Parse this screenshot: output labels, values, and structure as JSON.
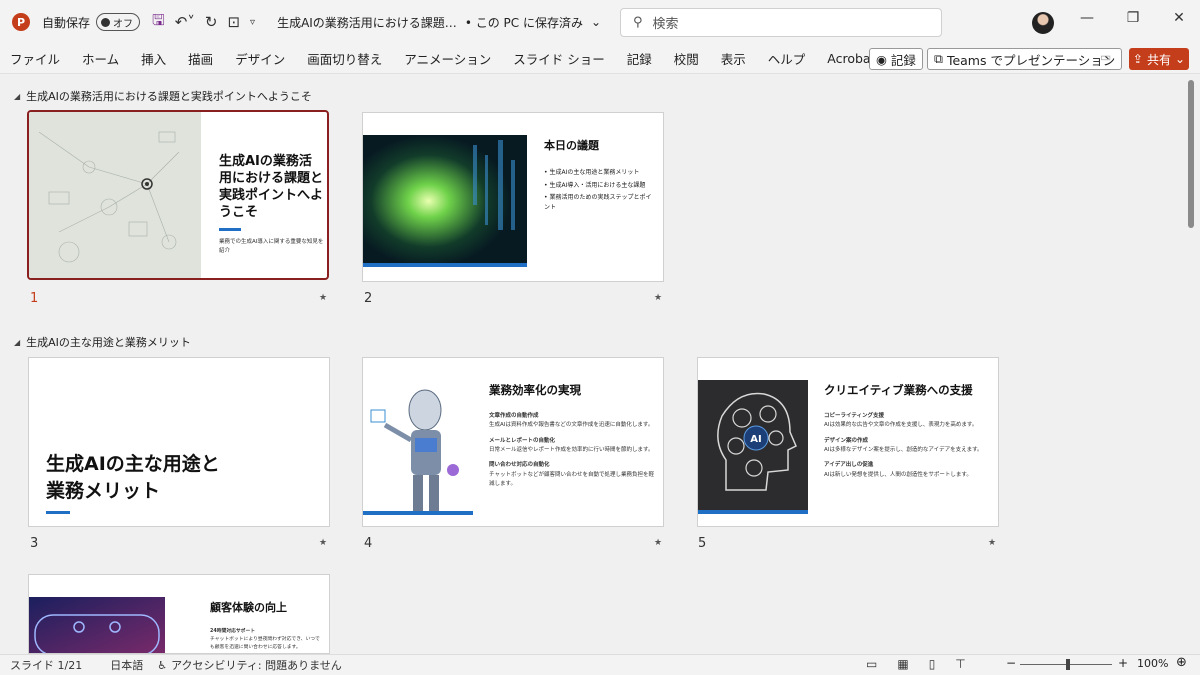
{
  "titlebar": {
    "app_icon": "P",
    "autosave_label": "自動保存",
    "autosave_state": "オフ",
    "doc_title": "生成AIの業務活用における課題…",
    "save_location": "• この PC に保存済み",
    "search_placeholder": "検索"
  },
  "menu": [
    "ファイル",
    "ホーム",
    "挿入",
    "描画",
    "デザイン",
    "画面切り替え",
    "アニメーション",
    "スライド ショー",
    "記録",
    "校閲",
    "表示",
    "ヘルプ",
    "Acrobat"
  ],
  "toolbar": {
    "record_label": "記録",
    "teams_label": "Teams でプレゼンテーション",
    "share_label": "共有"
  },
  "sections": [
    {
      "title": "生成AIの業務活用における課題と実践ポイントへようこそ"
    },
    {
      "title": "生成AIの主な用途と業務メリット"
    }
  ],
  "slides": {
    "s1": {
      "num": "1",
      "title": "生成AIの業務活用における課題と実践ポイントへようこそ",
      "subtitle": "業務での生成AI導入に関する重要な知見を紹介"
    },
    "s2": {
      "num": "2",
      "title": "本日の議題",
      "bullets": [
        "生成AIの主な用途と業務メリット",
        "生成AI導入・活用における主な課題",
        "業務活用のための実践ステップとポイント"
      ]
    },
    "s3": {
      "num": "3",
      "title_line1": "生成AIの主な用途と",
      "title_line2": "業務メリット"
    },
    "s4": {
      "num": "4",
      "title": "業務効率化の実現",
      "items": [
        {
          "h": "文章作成の自動作成",
          "t": "生成AIは資料作成や報告書などの文章作成を迅速に自動化します。"
        },
        {
          "h": "メールとレポートの自動化",
          "t": "日常メール返信やレポート作成を効率的に行い時間を節約します。"
        },
        {
          "h": "問い合わせ対応の自動化",
          "t": "チャットボットなどが顧客問い合わせを自動で処理し業務負担を軽減します。"
        }
      ]
    },
    "s5": {
      "num": "5",
      "title": "クリエイティブ業務への支援",
      "items": [
        {
          "h": "コピーライティング支援",
          "t": "AIは効果的な広告や文章の作成を支援し、表現力を高めます。"
        },
        {
          "h": "デザイン案の作成",
          "t": "AIは多様なデザイン案を提示し、創造的なアイデアを支えます。"
        },
        {
          "h": "アイデア出しの促進",
          "t": "AIは新しい発想を提供し、人間の創造性をサポートします。"
        }
      ]
    },
    "s6": {
      "title": "顧客体験の向上",
      "items": [
        {
          "h": "24時間対応サポート",
          "t": "チャットボットにより昼夜問わず対応でき、いつでも顧客を迅速に問い合わせに応答します。"
        }
      ]
    }
  },
  "status": {
    "slide_pos": "スライド 1/21",
    "language": "日本語",
    "accessibility": "アクセシビリティ: 問題ありません",
    "zoom": "100%"
  }
}
